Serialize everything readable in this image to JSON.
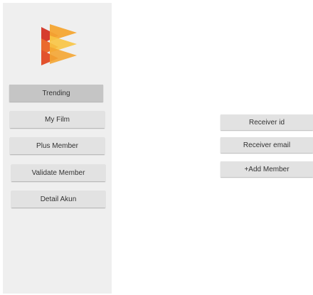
{
  "sidebar": {
    "logo": {
      "icon": "stacked-chevrons-logo",
      "colors": [
        "#f4a532",
        "#ea6a2d",
        "#d63d2f",
        "#f8c443"
      ]
    },
    "items": [
      {
        "label": "Trending",
        "active": true
      },
      {
        "label": "My Film",
        "active": false
      },
      {
        "label": "Plus Member",
        "active": false
      },
      {
        "label": "Validate Member",
        "active": false
      },
      {
        "label": "Detail Akun",
        "active": false
      }
    ]
  },
  "main": {
    "receiver_id_label": "Receiver id",
    "receiver_email_label": "Receiver email",
    "add_member_label": "+Add Member"
  }
}
